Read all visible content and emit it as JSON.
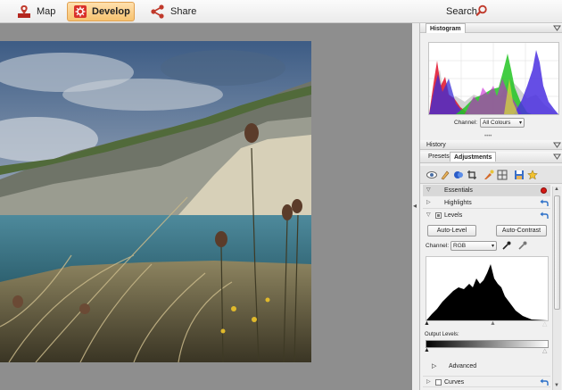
{
  "topbar": {
    "map_label": "Map",
    "develop_label": "Develop",
    "share_label": "Share",
    "search_label": "Search",
    "icons": {
      "map": "map-pin-icon",
      "develop": "develop-gear-icon",
      "share": "share-nodes-icon",
      "search": "search-icon"
    }
  },
  "histogram": {
    "title": "Histogram",
    "channel_label": "Channel:",
    "channel_value": "All Colours"
  },
  "history": {
    "title": "History"
  },
  "tabs": {
    "presets": "Presets",
    "adjustments": "Adjustments"
  },
  "adjustments": {
    "essentials": "Essentials",
    "highlights": "Highlights",
    "levels": "Levels",
    "auto_level": "Auto-Level",
    "auto_contrast": "Auto-Contrast",
    "channel_label": "Channel:",
    "channel_value": "RGB",
    "output_levels": "Output Levels:",
    "advanced": "Advanced",
    "curves": "Curves"
  },
  "colors": {
    "develop_bg": "#f7c370",
    "accent_red": "#d41a14",
    "undo_blue": "#2a6fc8"
  }
}
